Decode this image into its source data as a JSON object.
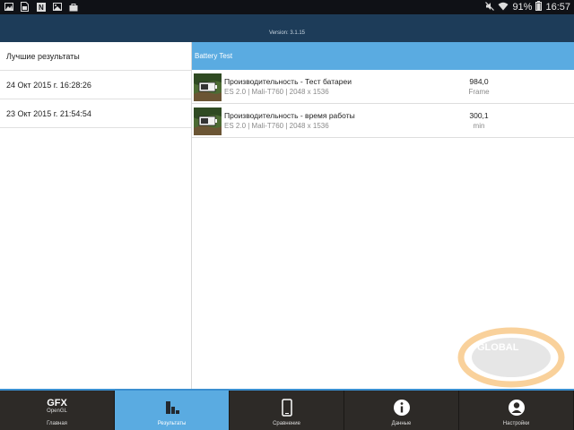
{
  "status_bar": {
    "battery": "91%",
    "time": "16:57"
  },
  "header": {
    "version": "Version: 3.1.15"
  },
  "left_panel": {
    "title": "Лучшие результаты",
    "dates": [
      "24 Окт 2015 г. 16:28:26",
      "23 Окт 2015 г. 21:54:54"
    ]
  },
  "right_panel": {
    "header": "Battery Test",
    "results": [
      {
        "title": "Производительность - Тест батареи",
        "subtitle": "ES 2.0 | Mali-T760 | 2048 x 1536",
        "value": "984,0",
        "unit": "Frame"
      },
      {
        "title": "Производительность - время работы",
        "subtitle": "ES 2.0 | Mali-T760 | 2048 x 1536",
        "value": "300,1",
        "unit": "min"
      }
    ]
  },
  "tabs": [
    {
      "label": "Главная",
      "icon": "gfx-logo",
      "logo_main": "GFX",
      "logo_sub": "OpenGL"
    },
    {
      "label": "Результаты",
      "icon": "bar-chart-icon"
    },
    {
      "label": "Сравнение",
      "icon": "phone-icon"
    },
    {
      "label": "Данные",
      "icon": "info-icon"
    },
    {
      "label": "Настройки",
      "icon": "user-icon"
    }
  ],
  "watermark": {
    "text": "GLOBAL"
  },
  "colors": {
    "header": "#1d3c59",
    "accent": "#5aabe1",
    "tabbar": "#2d2a27",
    "statusbar": "#0f1116"
  }
}
